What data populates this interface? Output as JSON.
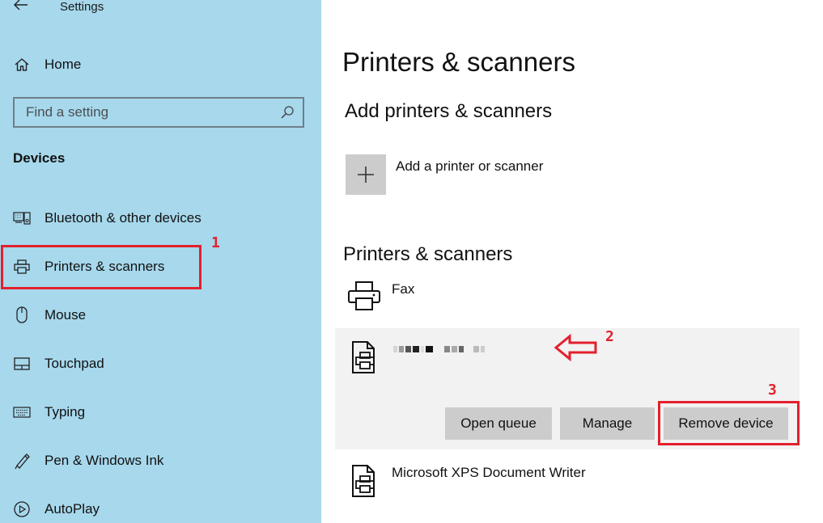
{
  "window": {
    "title": "Settings"
  },
  "sidebar": {
    "home_label": "Home",
    "search": {
      "placeholder": "Find a setting"
    },
    "section_heading": "Devices",
    "items": [
      {
        "label": "Bluetooth & other devices",
        "icon": "bluetooth-devices-icon"
      },
      {
        "label": "Printers & scanners",
        "icon": "printer-icon"
      },
      {
        "label": "Mouse",
        "icon": "mouse-icon"
      },
      {
        "label": "Touchpad",
        "icon": "touchpad-icon"
      },
      {
        "label": "Typing",
        "icon": "keyboard-icon"
      },
      {
        "label": "Pen & Windows Ink",
        "icon": "pen-icon"
      },
      {
        "label": "AutoPlay",
        "icon": "autoplay-icon"
      }
    ]
  },
  "main": {
    "title": "Printers & scanners",
    "add_section": {
      "heading": "Add printers & scanners",
      "add_label": "Add a printer or scanner"
    },
    "list_section": {
      "heading": "Printers & scanners",
      "printers": [
        {
          "name": "Fax"
        },
        {
          "name": "",
          "selected": true
        },
        {
          "name": "Microsoft XPS Document Writer"
        }
      ],
      "actions": {
        "open_queue": "Open queue",
        "manage": "Manage",
        "remove_device": "Remove device"
      }
    }
  },
  "annotations": {
    "step1": "1",
    "step2": "2",
    "step3": "3",
    "color": "#e3202d"
  },
  "colors": {
    "sidebar_bg": "#a7d8ec",
    "button_bg": "#cccccc",
    "selected_row_bg": "#f2f2f2"
  }
}
